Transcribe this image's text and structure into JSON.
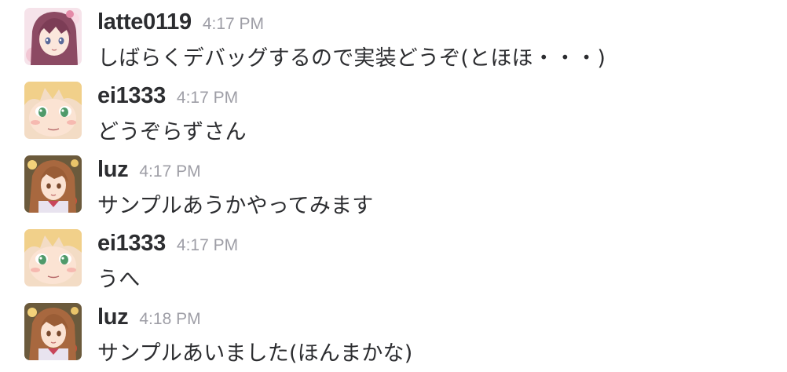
{
  "messages": [
    {
      "username": "latte0119",
      "time": "4:17 PM",
      "text": "しばらくデバッグするので実装どうぞ(とほほ・・・)",
      "avatar_icon": "avatar-purple-hair-girl"
    },
    {
      "username": "ei1333",
      "time": "4:17 PM",
      "text": "どうぞらずさん",
      "avatar_icon": "avatar-blonde-girl-green-eyes"
    },
    {
      "username": "luz",
      "time": "4:17 PM",
      "text": "サンプルあうかやってみます",
      "avatar_icon": "avatar-brown-hair-girl"
    },
    {
      "username": "ei1333",
      "time": "4:17 PM",
      "text": "うへ",
      "avatar_icon": "avatar-blonde-girl-green-eyes"
    },
    {
      "username": "luz",
      "time": "4:18 PM",
      "text": "サンプルあいました(ほんまかな)",
      "avatar_icon": "avatar-brown-hair-girl"
    }
  ],
  "colors": {
    "username": "#2c2d30",
    "timestamp": "#9e9ea6",
    "text": "#2c2d30",
    "background": "#ffffff"
  }
}
